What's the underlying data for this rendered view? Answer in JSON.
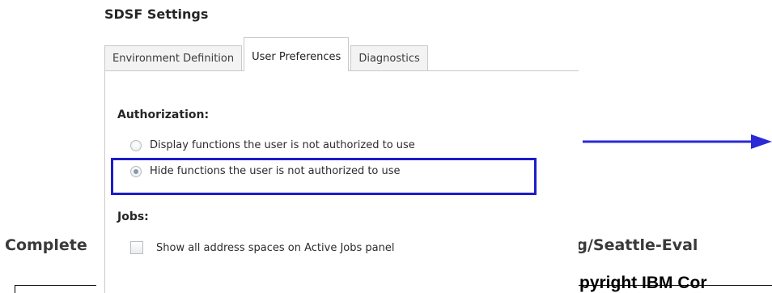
{
  "background": {
    "left_text": "Complete",
    "right_text": "rg/Seattle-Eval",
    "copyright_text": "pyright IBM Cor"
  },
  "panel": {
    "title": "SDSF Settings",
    "tabs": [
      {
        "label": "Environment Definition",
        "active": false
      },
      {
        "label": "User Preferences",
        "active": true
      },
      {
        "label": "Diagnostics",
        "active": false
      }
    ],
    "authorization": {
      "heading": "Authorization:",
      "options": [
        {
          "label": "Display functions the user is not authorized to use",
          "selected": false
        },
        {
          "label": "Hide functions the user is not authorized to use",
          "selected": true
        }
      ]
    },
    "jobs": {
      "heading": "Jobs:",
      "checkbox_label": "Show all address spaces on Active Jobs panel",
      "checked": false
    }
  },
  "annotation": {
    "highlight_color": "#1c1ccc",
    "arrow_color": "#2a2ad6"
  }
}
